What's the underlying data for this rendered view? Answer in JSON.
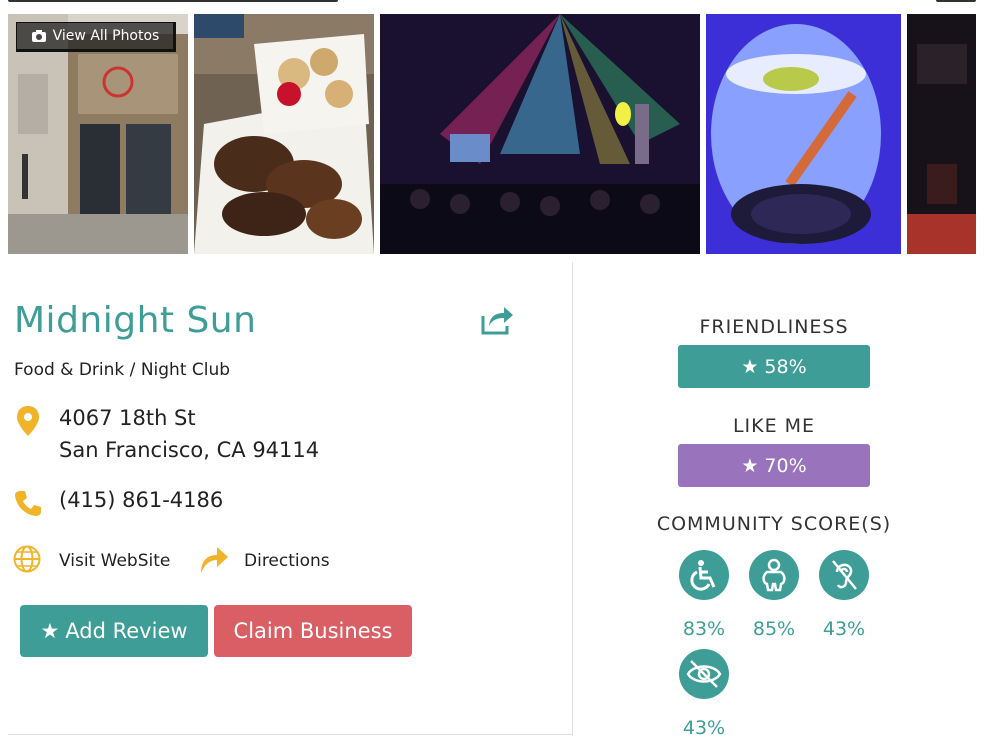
{
  "gallery": {
    "view_all_label": "View All Photos"
  },
  "business": {
    "name": "Midnight Sun",
    "category": "Food & Drink",
    "subcategory": "Night Club",
    "category_separator": "/",
    "address_line1": "4067 18th St",
    "address_line2": "San Francisco, CA 94114",
    "phone": "(415) 861-4186",
    "website_label": "Visit WebSite",
    "directions_label": "Directions"
  },
  "actions": {
    "add_review_label": "Add Review",
    "claim_business_label": "Claim Business"
  },
  "scores": {
    "friendliness_label": "FRIENDLINESS",
    "friendliness_value": "58%",
    "like_me_label": "LIKE ME",
    "like_me_value": "70%",
    "community_label": "COMMUNITY SCORE(S)",
    "community": [
      {
        "icon": "wheelchair-icon",
        "value": "83%"
      },
      {
        "icon": "body-size-icon",
        "value": "85%"
      },
      {
        "icon": "deaf-icon",
        "value": "43%"
      },
      {
        "icon": "blind-icon",
        "value": "43%"
      }
    ]
  },
  "colors": {
    "accent": "#3e9e97",
    "like_me": "#9a73bd",
    "claim": "#d95f64",
    "icon_gold": "#f0b428"
  }
}
